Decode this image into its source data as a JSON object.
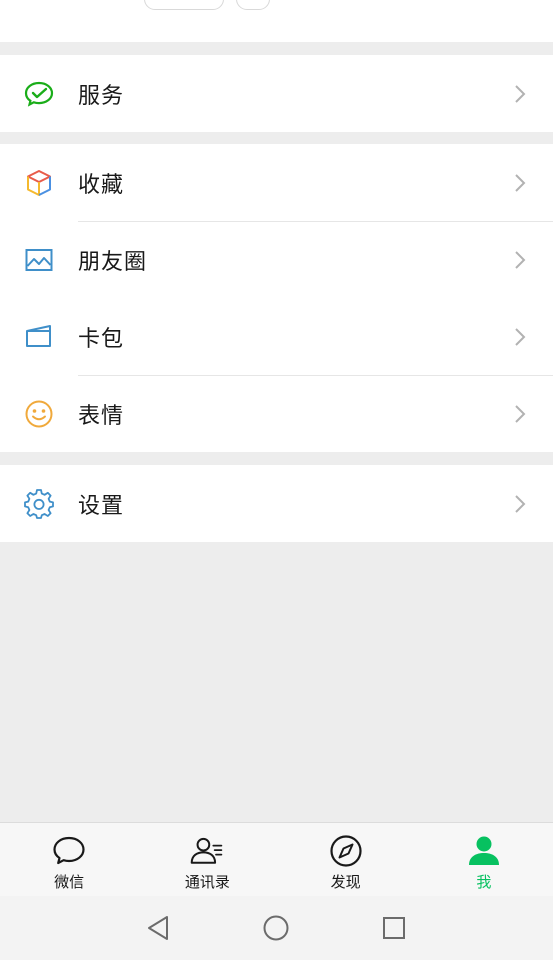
{
  "menu_groups": [
    {
      "items": [
        {
          "label": "服务",
          "icon": "wechat-pay-icon"
        }
      ]
    },
    {
      "items": [
        {
          "label": "收藏",
          "icon": "cube-icon"
        },
        {
          "label": "朋友圈",
          "icon": "picture-icon"
        },
        {
          "label": "卡包",
          "icon": "card-icon"
        },
        {
          "label": "表情",
          "icon": "smile-icon"
        }
      ]
    },
    {
      "items": [
        {
          "label": "设置",
          "icon": "gear-icon"
        }
      ]
    }
  ],
  "tabbar": {
    "tabs": [
      {
        "label": "微信",
        "icon": "chat-bubble-icon",
        "active": false
      },
      {
        "label": "通讯录",
        "icon": "contacts-icon",
        "active": false
      },
      {
        "label": "发现",
        "icon": "compass-icon",
        "active": false
      },
      {
        "label": "我",
        "icon": "person-icon",
        "active": true
      }
    ]
  },
  "colors": {
    "accent": "#07c160",
    "background": "#ededed",
    "text": "#191919"
  },
  "system_nav": [
    "back-icon",
    "home-icon",
    "recents-icon"
  ]
}
